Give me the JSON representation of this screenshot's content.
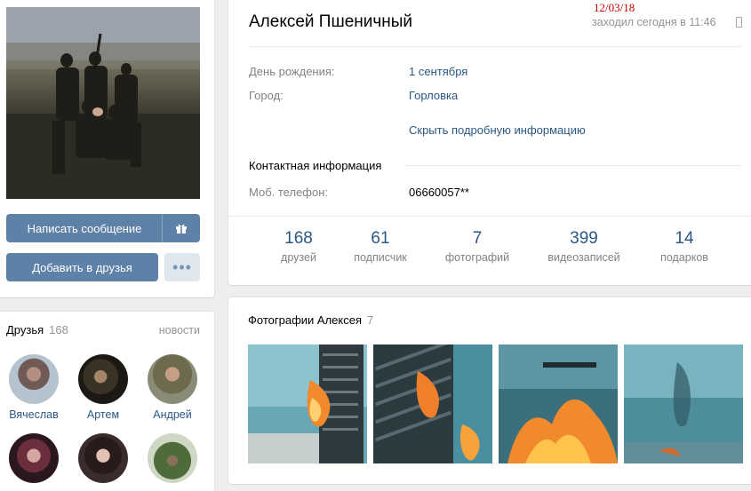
{
  "profile": {
    "name": "Алексей Пшеничный",
    "date_stamp": "12/03/18",
    "online_status": "заходил сегодня в 11:46",
    "info": [
      {
        "label": "День рождения:",
        "value": "1 сентября"
      },
      {
        "label": "Город:",
        "value": "Горловка"
      }
    ],
    "hide_details": "Скрыть подробную информацию",
    "contact_title": "Контактная информация",
    "phone_label": "Моб. телефон:",
    "phone_value": "06660057**"
  },
  "actions": {
    "message": "Написать сообщение",
    "add_friend": "Добавить в друзья",
    "more": "•••"
  },
  "counters": [
    {
      "num": "168",
      "label": "друзей"
    },
    {
      "num": "61",
      "label": "подписчик"
    },
    {
      "num": "7",
      "label": "фотографий"
    },
    {
      "num": "399",
      "label": "видеозаписей"
    },
    {
      "num": "14",
      "label": "подарков"
    }
  ],
  "friends": {
    "title": "Друзья",
    "count": "168",
    "news_link": "новости",
    "items": [
      {
        "name": "Вячеслав"
      },
      {
        "name": "Артем"
      },
      {
        "name": "Андрей"
      },
      {
        "name": ""
      },
      {
        "name": ""
      },
      {
        "name": ""
      }
    ]
  },
  "photos": {
    "title": "Фотографии Алексея",
    "count": "7"
  },
  "icons": {
    "gift": "gift-icon",
    "phone": "mobile-phone-icon"
  },
  "colors": {
    "accent": "#5e81a8",
    "link": "#2a5885",
    "muted": "#828282",
    "date_stamp": "#cc0000"
  }
}
